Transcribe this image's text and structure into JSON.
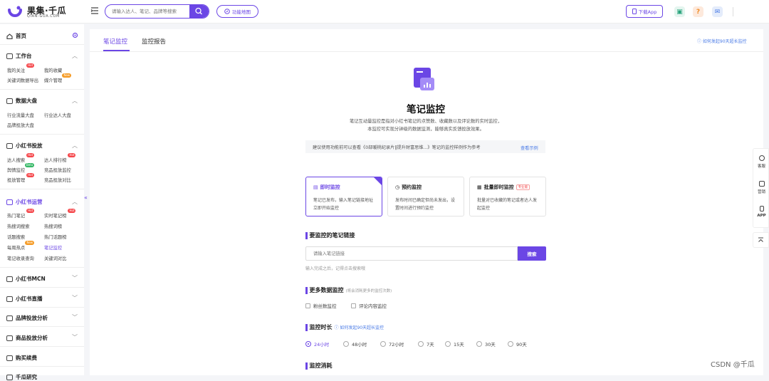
{
  "header": {
    "brand_cn": "果集·千瓜",
    "brand_en": "QIAN-GUA.COM",
    "search_placeholder": "请输入达人、笔记、品牌等搜索",
    "function_map": "功能地图",
    "download_app": "下载App",
    "accent": "#6b46e5"
  },
  "sidebar": {
    "home": "首页",
    "sections": [
      {
        "title": "工作台",
        "items": [
          {
            "label": "我的关注",
            "badge": "Hot"
          },
          {
            "label": "我的收藏"
          },
          {
            "label": "关键词数据导出"
          },
          {
            "label": "媒介管理",
            "badge": "New"
          }
        ]
      },
      {
        "title": "数据大盘",
        "items": [
          {
            "label": "行业流量大盘"
          },
          {
            "label": "行业达人大盘"
          },
          {
            "label": "品牌投放大盘"
          }
        ]
      },
      {
        "title": "小红书投放",
        "items": [
          {
            "label": "达人搜索",
            "badge": "Hot"
          },
          {
            "label": "达人排行榜",
            "badge": "Hot"
          },
          {
            "label": "舆情监控",
            "badge": "Beta"
          },
          {
            "label": "竞品投放监控"
          },
          {
            "label": "投放管理",
            "badge": "Hot"
          },
          {
            "label": "竞品投放对比"
          }
        ]
      },
      {
        "title": "小红书运营",
        "items": [
          {
            "label": "热门笔记",
            "badge": "Hot"
          },
          {
            "label": "实时笔记榜",
            "badge": "Hot"
          },
          {
            "label": "热搜词搜索"
          },
          {
            "label": "热搜词榜"
          },
          {
            "label": "话题搜索"
          },
          {
            "label": "热门话题榜"
          },
          {
            "label": "每周热点",
            "badge": "New"
          },
          {
            "label": "笔记监控"
          },
          {
            "label": "笔记收录查询"
          },
          {
            "label": "关键词对比"
          }
        ]
      },
      {
        "title": "小红书MCN"
      },
      {
        "title": "小红书直播"
      },
      {
        "title": "品牌投放分析"
      },
      {
        "title": "商品投放分析"
      },
      {
        "title": "购买续费"
      },
      {
        "title": "千瓜研究"
      }
    ],
    "collapse_glyph": "«"
  },
  "tabs": [
    "笔记监控",
    "监控报告"
  ],
  "top_link": "如何发起90天超长监控",
  "hero": {
    "title": "笔记监控",
    "desc1": "笔记互动量监控是指对小红书笔记的点赞数、收藏数以及评论数的实时监控，",
    "desc2": "本监控可实现分钟级的数据监测，能够真实反馈投放效果。",
    "tip": "建议使用功能前可以查看《0部暖桃纪录片‖提升财富思维...》笔记的监控样例作为参考",
    "tip_link": "查看示例"
  },
  "cards": [
    {
      "title": "即时监控",
      "desc": "笔记已发布，输入笔记链接地址立即开始监控",
      "selected": true
    },
    {
      "title": "预约监控",
      "desc": "发布时间已确定但尚未发出，设置时间进行预约监控",
      "selected": false
    },
    {
      "title": "批量即时监控",
      "badge": "专业版",
      "desc": "批量对已收藏的笔记或者达人发起监控",
      "selected": false
    }
  ],
  "link_section": {
    "title": "要监控的笔记链接",
    "placeholder": "请输入笔记链接",
    "button": "搜索",
    "hint": "输入完成之后，记得点击搜索哦"
  },
  "more_section": {
    "title": "更多数据监控",
    "sub": "(将会消耗更多的监控次数)",
    "options": [
      "粉丝数监控",
      "评论内容监控"
    ]
  },
  "duration_section": {
    "title": "监控时长",
    "link": "如何发起90天超长监控",
    "options": [
      "24小时",
      "48小时",
      "72小时",
      "7天",
      "15天",
      "30天",
      "90天"
    ],
    "selected": "24小时"
  },
  "consume_section": {
    "title": "监控消耗"
  },
  "float_bar": [
    "客服",
    "营销",
    "APP"
  ],
  "watermark": "CSDN @千瓜"
}
